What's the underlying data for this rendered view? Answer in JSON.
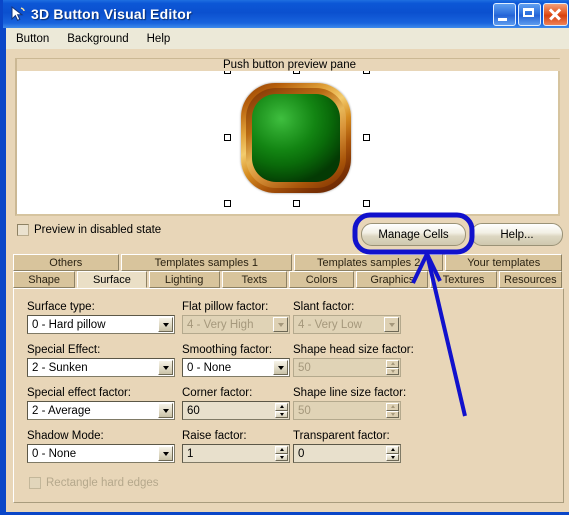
{
  "window": {
    "title": "3D Button Visual Editor",
    "icon": "app-pointer-icon",
    "caption_buttons": {
      "minimize": "minimize-icon",
      "maximize": "maximize-icon",
      "close": "close-icon"
    }
  },
  "menubar": {
    "items": [
      {
        "label": "Button"
      },
      {
        "label": "Background"
      },
      {
        "label": "Help"
      }
    ]
  },
  "preview": {
    "caption": "Push button preview pane",
    "disabled_checkbox_label": "Preview in disabled state",
    "disabled_checkbox_checked": false
  },
  "actions": {
    "manage_cells_label": "Manage Cells",
    "help_label": "Help..."
  },
  "tabs_row1": [
    {
      "label": "Others",
      "active": false
    },
    {
      "label": "Templates samples 1",
      "active": false
    },
    {
      "label": "Templates samples 2",
      "active": false
    },
    {
      "label": "Your templates",
      "active": false
    }
  ],
  "tabs_row2": [
    {
      "label": "Shape",
      "active": false
    },
    {
      "label": "Surface",
      "active": true
    },
    {
      "label": "Lighting",
      "active": false
    },
    {
      "label": "Texts",
      "active": false
    },
    {
      "label": "Colors",
      "active": false
    },
    {
      "label": "Graphics",
      "active": false
    },
    {
      "label": "Textures",
      "active": false
    },
    {
      "label": "Resources",
      "active": false
    }
  ],
  "surface_fields": {
    "surface_type": {
      "label": "Surface type:",
      "value": "0 - Hard pillow",
      "disabled": false
    },
    "flat_pillow_factor": {
      "label": "Flat pillow factor:",
      "value": "4 - Very High",
      "disabled": true
    },
    "slant_factor": {
      "label": "Slant factor:",
      "value": "4 - Very Low",
      "disabled": true
    },
    "special_effect": {
      "label": "Special Effect:",
      "value": "2 - Sunken",
      "disabled": false
    },
    "smoothing_factor": {
      "label": "Smoothing factor:",
      "value": "0 - None",
      "disabled": false
    },
    "shape_head_size_factor": {
      "label": "Shape head size factor:",
      "value": "50",
      "disabled": true
    },
    "special_effect_factor": {
      "label": "Special effect factor:",
      "value": "2 - Average",
      "disabled": false
    },
    "corner_factor": {
      "label": "Corner factor:",
      "value": "60",
      "disabled": false
    },
    "shape_line_size_factor": {
      "label": "Shape line size factor:",
      "value": "50",
      "disabled": true
    },
    "shadow_mode": {
      "label": "Shadow Mode:",
      "value": "0 - None",
      "disabled": false
    },
    "raise_factor": {
      "label": "Raise factor:",
      "value": "1",
      "disabled": false
    },
    "transparent_factor": {
      "label": "Transparent factor:",
      "value": "0",
      "disabled": false
    },
    "rectangle_hard_edges": {
      "label": "Rectangle hard edges",
      "checked": false,
      "disabled": true
    }
  },
  "annotation": {
    "color": "#1111cc",
    "shape": "rounded-rect-highlight-with-arrow",
    "target": "Manage Cells"
  },
  "colors": {
    "titlebar_blue": "#0b50cf",
    "client_tan": "#e8d6b8",
    "tab_tan": "#d8c49c",
    "active_tab": "#eadfc6",
    "button_green": "#138513",
    "bezel_copper": "#b7600c",
    "annotation_blue": "#1111cc"
  }
}
